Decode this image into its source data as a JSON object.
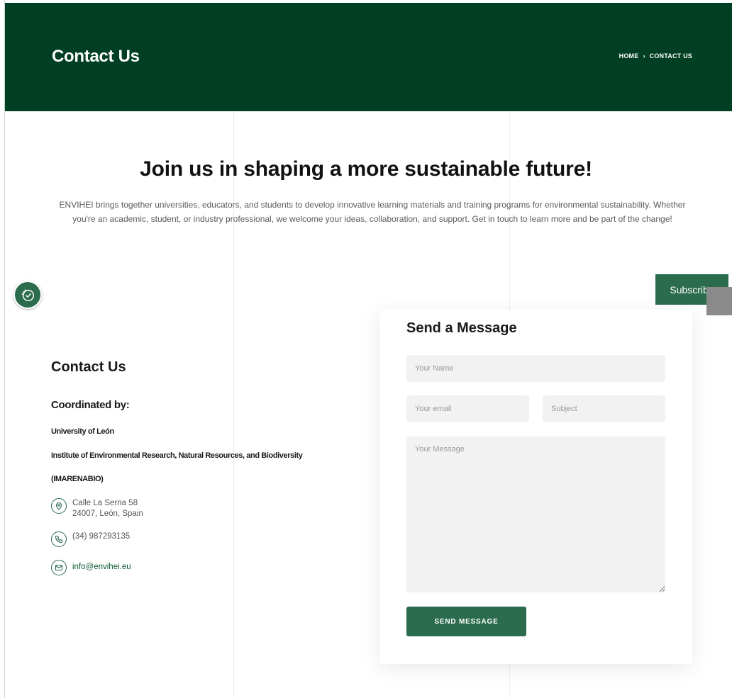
{
  "header": {
    "title": "Contact Us",
    "breadcrumb": {
      "home": "HOME",
      "separator": "›",
      "current": "CONTACT US"
    }
  },
  "intro": {
    "headline": "Join us in shaping a more sustainable future!",
    "text": "ENVIHEI brings together universities, educators, and students to develop innovative learning materials and training programs for environmental sustainability. Whether you're an academic, student, or industry professional, we welcome your ideas, collaboration, and support. Get in touch to learn more and be part of the change!"
  },
  "floating": {
    "subscribe_label": "Subscribe",
    "badge_icon": "check-clock-icon"
  },
  "contact": {
    "heading": "Contact Us",
    "coordinated_label": "Coordinated by:",
    "university": "University of León",
    "institute": "Institute of Environmental Research, Natural Resources, and Biodiversity",
    "institute_abbr": "(IMARENABIO)",
    "address_line1": "Calle La Serna 58",
    "address_line2": "24007, León, Spain",
    "phone": "(34) 987293135",
    "email": "info@envihei.eu",
    "icons": {
      "address": "location-pin-icon",
      "phone": "phone-icon",
      "email": "mail-icon"
    }
  },
  "form": {
    "title": "Send a Message",
    "name_placeholder": "Your Name",
    "email_placeholder": "Your email",
    "subject_placeholder": "Subject",
    "message_placeholder": "Your Message",
    "submit_label": "SEND MESSAGE"
  },
  "colors": {
    "header_bg": "#003f23",
    "accent": "#2b6b4e",
    "link": "#0f5a34",
    "field_bg": "#f2f2f2"
  }
}
